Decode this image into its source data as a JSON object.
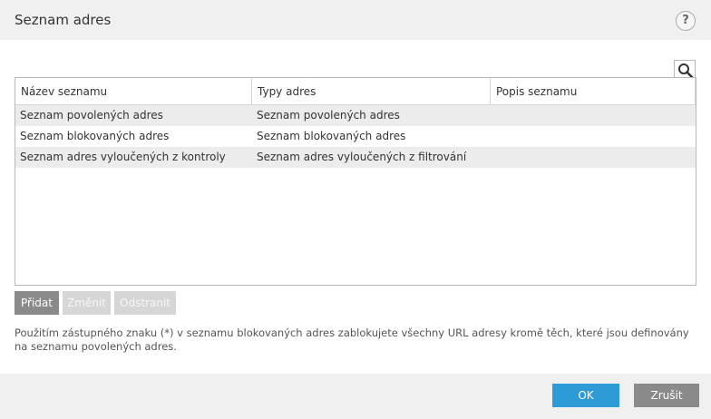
{
  "dialog": {
    "title": "Seznam adres",
    "help_label": "?"
  },
  "search": {
    "icon": "search-icon"
  },
  "table": {
    "columns": [
      "Název seznamu",
      "Typy adres",
      "Popis seznamu"
    ],
    "rows": [
      [
        "Seznam povolených adres",
        "Seznam povolených adres",
        ""
      ],
      [
        "Seznam blokovaných adres",
        "Seznam blokovaných adres",
        ""
      ],
      [
        "Seznam adres vyloučených z kontroly",
        "Seznam adres vyloučených z filtrování",
        ""
      ]
    ]
  },
  "actions": {
    "add": "Přidat",
    "edit": "Změnit",
    "remove": "Odstranit"
  },
  "note": "Použitím zástupného znaku (*) v seznamu blokovaných adres zablokujete všechny URL adresy kromě těch, které jsou definovány na seznamu povolených adres.",
  "footer": {
    "ok": "OK",
    "cancel": "Zrušit"
  },
  "colors": {
    "accent": "#2d9bd6",
    "header_bg": "#f0f0f0",
    "button_gray": "#8a8a8a",
    "button_disabled": "#d6d6d6"
  }
}
